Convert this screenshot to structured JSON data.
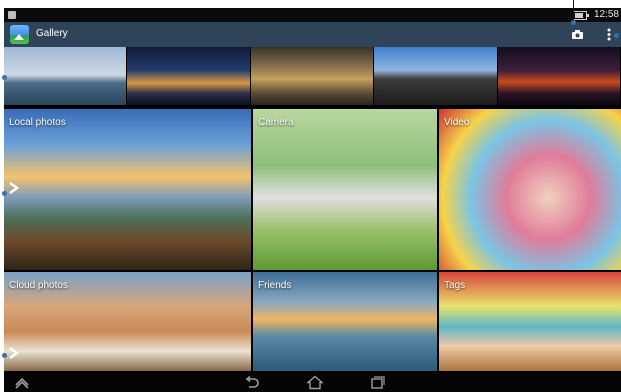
{
  "status_bar": {
    "time": "12:58",
    "battery_level": 0.8
  },
  "action_bar": {
    "title": "Gallery",
    "icons": [
      "gallery-app-icon",
      "camera-icon",
      "overflow-menu-icon"
    ]
  },
  "strip": {
    "thumbnails": [
      "statue-of-liberty",
      "city-skyline-night",
      "fountain-statue",
      "atlas-statue",
      "harbor-night"
    ]
  },
  "albums": [
    {
      "label": "Local photos",
      "has_chevron": true
    },
    {
      "label": "Camera",
      "has_chevron": false
    },
    {
      "label": "Video",
      "has_chevron": false
    },
    {
      "label": "Cloud photos",
      "has_chevron": true
    },
    {
      "label": "Friends",
      "has_chevron": false
    },
    {
      "label": "Tags",
      "has_chevron": false
    }
  ],
  "nav_bar": {
    "icons": [
      "up-icon",
      "back-icon",
      "home-icon",
      "recent-apps-icon"
    ]
  },
  "colors": {
    "action_bar_bg": "#2f4359",
    "status_bar_bg": "#0b0b0b",
    "nav_bar_bg": "#050505",
    "callout_dot": "#3a6fb2"
  }
}
